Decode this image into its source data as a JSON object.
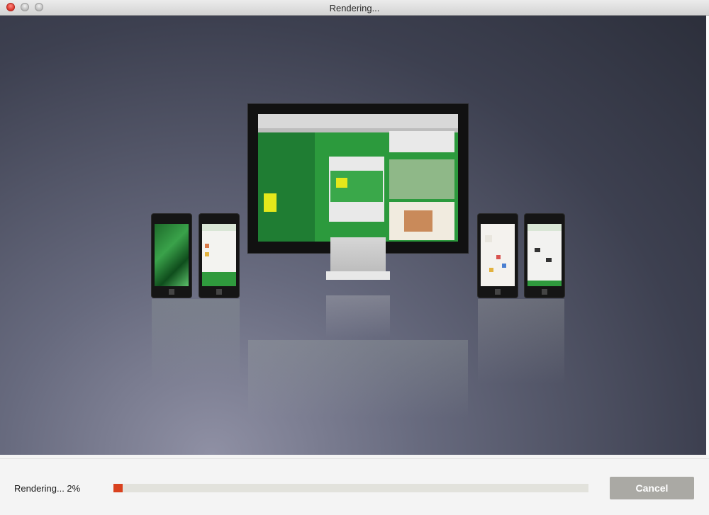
{
  "window": {
    "title": "Rendering..."
  },
  "status": {
    "label": "Rendering... 2%",
    "progress": 0.02,
    "progress_color": "#d9411e"
  },
  "actions": {
    "cancel_label": "Cancel"
  },
  "icons": {
    "close": "close-traffic-light-icon",
    "minimize": "minimize-traffic-light-icon",
    "zoom": "zoom-traffic-light-icon"
  }
}
